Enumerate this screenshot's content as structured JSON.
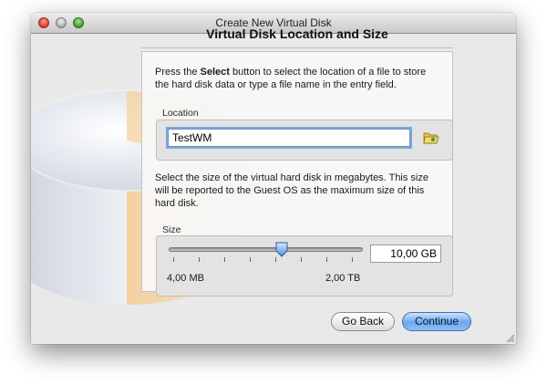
{
  "window": {
    "title": "Create New Virtual Disk"
  },
  "page": {
    "heading": "Virtual Disk Location and Size"
  },
  "location": {
    "description_prefix": "Press the ",
    "description_bold": "Select",
    "description_suffix": " button to select the location of a file to store the hard disk data or type a file name in the entry field.",
    "group_label": "Location",
    "value": "TestWM",
    "folder_button_icon": "folder-open-icon"
  },
  "size": {
    "description": "Select the size of the virtual hard disk in megabytes. This size will be reported to the Guest OS as the maximum size of this hard disk.",
    "group_label": "Size",
    "value_text": "10,00 GB",
    "min_label": "4,00 MB",
    "max_label": "2,00 TB",
    "slider_fraction": 0.58
  },
  "buttons": {
    "back": "Go Back",
    "continue": "Continue"
  },
  "colors": {
    "accent": "#6aa7ec",
    "focus_ring": "#7aa9e0"
  }
}
